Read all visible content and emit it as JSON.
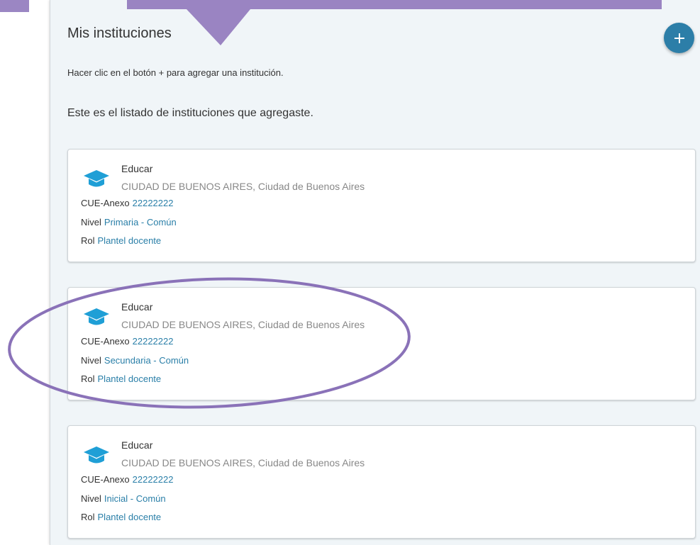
{
  "header": {
    "title": "Mis instituciones",
    "add_label": "+"
  },
  "instructions": "Hacer clic en el botón + para agregar una institución.",
  "subtitle": "Este es el listado de instituciones que agregaste.",
  "labels": {
    "cue": "CUE-Anexo",
    "nivel": "Nivel",
    "rol": "Rol"
  },
  "institutions": [
    {
      "name": "Educar",
      "location": "CIUDAD DE BUENOS AIRES, Ciudad de Buenos Aires",
      "cue": "22222222",
      "nivel": "Primaria - Común",
      "rol": "Plantel docente"
    },
    {
      "name": "Educar",
      "location": "CIUDAD DE BUENOS AIRES, Ciudad de Buenos Aires",
      "cue": "22222222",
      "nivel": "Secundaria - Común",
      "rol": "Plantel docente"
    },
    {
      "name": "Educar",
      "location": "CIUDAD DE BUENOS AIRES, Ciudad de Buenos Aires",
      "cue": "22222222",
      "nivel": "Inicial - Común",
      "rol": "Plantel docente"
    }
  ],
  "colors": {
    "accent": "#2c7ea8",
    "link": "#2a7fa8",
    "annotation": "#9a84c2",
    "panel_bg": "#f0f5f8"
  },
  "icons": {
    "add": "plus-icon",
    "institution": "graduation-cap-icon"
  }
}
